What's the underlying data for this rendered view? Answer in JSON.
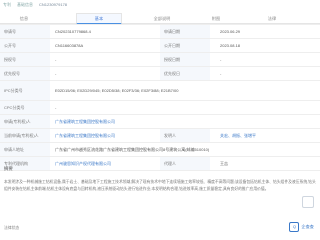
{
  "breadcrumb": [
    "专利",
    "基础信息",
    "CN1230979178"
  ],
  "tabs": [
    "信息",
    "基本",
    "全部说明",
    "附图",
    "法律"
  ],
  "active_tab_index": 1,
  "fields": [
    {
      "l": "申请号",
      "v": "CN202310779868.4",
      "l2": "申请日期",
      "v2": "2023.06.29"
    },
    {
      "l": "公开号",
      "v": "CN116603878A",
      "l2": "公开日期",
      "v2": "2023.08.18"
    },
    {
      "l": "授权号",
      "v": "-",
      "l2": "授权日期",
      "v2": "-"
    },
    {
      "l": "优先权号",
      "v": "-",
      "l2": "优先权日",
      "v2": "-"
    },
    {
      "l": "IPC分类号",
      "v": "E02D15/06; E02D29/045; E02D5/38; E02F3/36; E02F3/88; E21B7/00",
      "l2": "",
      "v2": ""
    },
    {
      "l": "CPC分类号",
      "v": "-",
      "l2": "",
      "v2": ""
    },
    {
      "l": "申请(专利权)人",
      "v": "广东省建筑工程集团控股有限公司",
      "l2": "",
      "v2": ""
    },
    {
      "l": "当前申请(专利权)人",
      "v": "广东省建筑工程集团控股有限公司",
      "l2": "发明人",
      "v2": "关宏、胡振、张增平"
    },
    {
      "l": "申请人地址",
      "v": "广东省广州市越秀区流花路广东省建筑工程集团控股有限公司8号建筑公寓(邮编510010)",
      "l2": "",
      "v2": ""
    },
    {
      "l": "专利代理机构",
      "v": "广州骏思知识产权代理有限公司",
      "l2": "代理人",
      "v2": "王吉"
    }
  ],
  "abstract_heading": "摘要",
  "abstract_text": "本发明涉及一种机械施工钻机设备,属于岩土、基础及地下工程施工技术领域,解决了现有技术中地下连续墙施工效率较低、精度不高等问题;该设备包括钻机主体、钻头组件及液压系统,钻头组件安装在钻机主体前端;钻机主体设有底盘与回转机构,液压系统驱动钻头进行钻进作业;本发明结构合理,钻进效率高,施工质量稳定,具有良好的推广应用价值。",
  "footer_text": "法律状态",
  "logo_text": "企查查",
  "logo_mark": "Q"
}
